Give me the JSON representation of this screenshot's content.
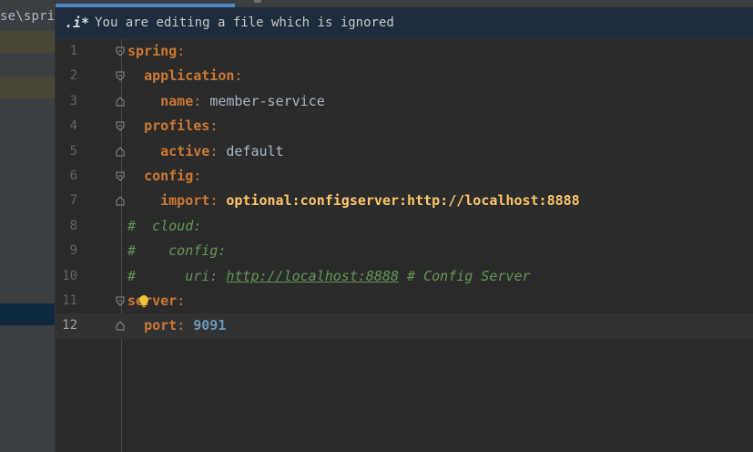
{
  "project_panel": {
    "path_fragment": "se\\spri"
  },
  "banner": {
    "icon_label": ".i*",
    "message": "You are editing a file which is ignored"
  },
  "editor": {
    "current_line": 12,
    "lines": [
      {
        "num": "1"
      },
      {
        "num": "2"
      },
      {
        "num": "3"
      },
      {
        "num": "4"
      },
      {
        "num": "5"
      },
      {
        "num": "6"
      },
      {
        "num": "7"
      },
      {
        "num": "8"
      },
      {
        "num": "9"
      },
      {
        "num": "10"
      },
      {
        "num": "11"
      },
      {
        "num": "12"
      }
    ],
    "code": {
      "l1_key": "spring",
      "l2_key": "application",
      "l3_key": "name",
      "l3_value": "member-service",
      "l4_key": "profiles",
      "l5_key": "active",
      "l5_value": "default",
      "l6_key": "config",
      "l7_key": "import",
      "l7_value": "optional:configserver:http://localhost:8888",
      "l8_comment": "#  cloud:",
      "l9_comment": "#    config:",
      "l10_comment_prefix": "#      uri: ",
      "l10_comment_url": "http://localhost:8888",
      "l10_comment_suffix": " # Config Server",
      "l11_key": "server",
      "l12_key": "port",
      "l12_value": "9091"
    }
  },
  "colors": {
    "background": "#2b2b2b",
    "key": "#cc7832",
    "string": "#a9b7c6",
    "highlight_value": "#ffc66d",
    "number": "#6897bb",
    "comment": "#629755",
    "banner_bg": "#1f2c3d",
    "tab_accent": "#4a88c7"
  },
  "icons": {
    "fold": "fold-marker-icon",
    "intention": "lightbulb-icon"
  }
}
